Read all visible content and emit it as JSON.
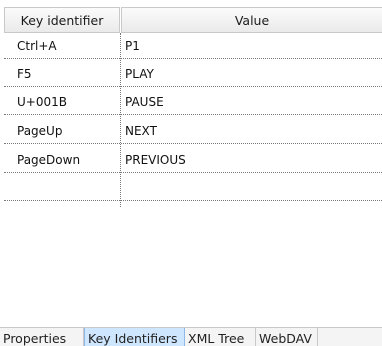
{
  "table": {
    "headers": {
      "key": "Key identifier",
      "value": "Value"
    },
    "rows": [
      {
        "key": "Ctrl+A",
        "value": "P1"
      },
      {
        "key": "F5",
        "value": "PLAY"
      },
      {
        "key": "U+001B",
        "value": "PAUSE"
      },
      {
        "key": "PageUp",
        "value": "NEXT"
      },
      {
        "key": "PageDown",
        "value": "PREVIOUS"
      }
    ]
  },
  "tabs": [
    {
      "label": "Properties",
      "active": false
    },
    {
      "label": "Key Identifiers",
      "active": true
    },
    {
      "label": "XML Tree",
      "active": false
    },
    {
      "label": "WebDAV",
      "active": false
    }
  ],
  "colors": {
    "active_tab_bg": "#cfe6ff",
    "header_bg": "#f0f0f0",
    "row_separator": "#7a7a7a"
  }
}
